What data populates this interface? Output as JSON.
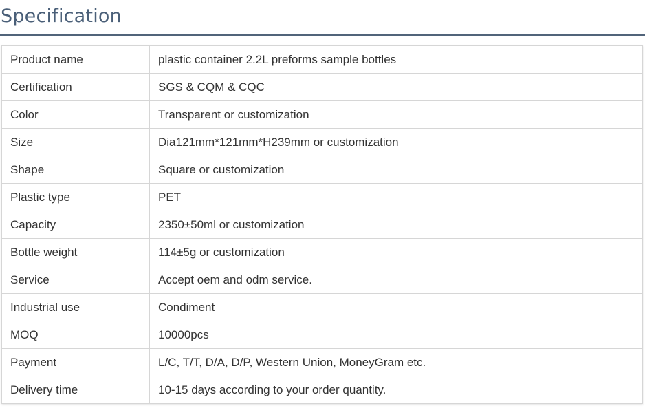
{
  "section": {
    "title": "Specification"
  },
  "specs": [
    {
      "label": "Product name",
      "value": "plastic container 2.2L preforms sample bottles"
    },
    {
      "label": "Certification",
      "value": "SGS & CQM & CQC"
    },
    {
      "label": "Color",
      "value": "Transparent or customization"
    },
    {
      "label": "Size",
      "value": "Dia121mm*121mm*H239mm or customization"
    },
    {
      "label": "Shape",
      "value": "Square or customization"
    },
    {
      "label": "Plastic type",
      "value": "PET"
    },
    {
      "label": "Capacity",
      "value": "2350±50ml or customization"
    },
    {
      "label": "Bottle weight",
      "value": "114±5g or customization"
    },
    {
      "label": "Service",
      "value": "Accept oem and odm service."
    },
    {
      "label": "Industrial use",
      "value": "Condiment"
    },
    {
      "label": "MOQ",
      "value": "10000pcs"
    },
    {
      "label": "Payment",
      "value": "L/C, T/T, D/A, D/P, Western Union, MoneyGram etc."
    },
    {
      "label": "Delivery time",
      "value": "10-15 days according to your order quantity."
    }
  ],
  "colors": {
    "heading": "#4a5f78",
    "rule": "#51647a",
    "border": "#d6d6d6",
    "text": "#333333"
  }
}
